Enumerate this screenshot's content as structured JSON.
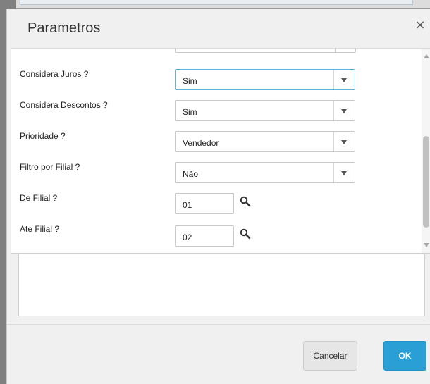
{
  "dialog": {
    "title": "Parametros",
    "close_glyph": "×"
  },
  "params": [
    {
      "label": "Considera Juros ?",
      "type": "select",
      "value": "Sim",
      "focused": true
    },
    {
      "label": "Considera Descontos ?",
      "type": "select",
      "value": "Sim",
      "focused": false
    },
    {
      "label": "Prioridade ?",
      "type": "select",
      "value": "Vendedor",
      "focused": false
    },
    {
      "label": "Filtro por Filial ?",
      "type": "select",
      "value": "Não",
      "focused": false
    },
    {
      "label": "De Filial ?",
      "type": "lookup",
      "value": "01"
    },
    {
      "label": "Ate Filial ?",
      "type": "lookup",
      "value": "02"
    }
  ],
  "icons": {
    "dropdown": "chevron-down-icon",
    "lookup": "search-icon",
    "close": "close-icon"
  },
  "footer": {
    "cancel_label": "Cancelar",
    "ok_label": "OK"
  },
  "colors": {
    "primary": "#2a9fd6",
    "focus_border": "#5ab3d8",
    "backdrop": "#808080"
  }
}
